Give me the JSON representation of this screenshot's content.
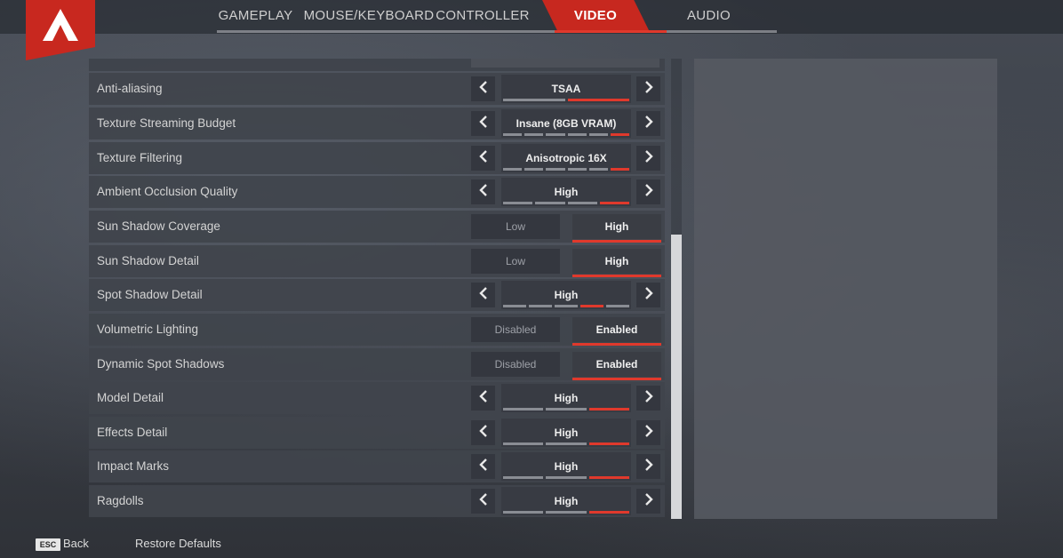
{
  "nav": {
    "tabs": [
      {
        "label": "GAMEPLAY",
        "active": false
      },
      {
        "label": "MOUSE/KEYBOARD",
        "active": false
      },
      {
        "label": "CONTROLLER",
        "active": false
      },
      {
        "label": "VIDEO",
        "active": true
      },
      {
        "label": "AUDIO",
        "active": false
      }
    ],
    "accent_color": "#c7281f"
  },
  "logo": {
    "icon": "apex-logo-icon"
  },
  "settings": [
    {
      "label": "Anti-aliasing",
      "type": "stepper",
      "value": "TSAA",
      "level": 2,
      "levels": 2
    },
    {
      "label": "Texture Streaming Budget",
      "type": "stepper",
      "value": "Insane (8GB VRAM)",
      "level": 6,
      "levels": 6
    },
    {
      "label": "Texture Filtering",
      "type": "stepper",
      "value": "Anisotropic 16X",
      "level": 6,
      "levels": 6
    },
    {
      "label": "Ambient Occlusion Quality",
      "type": "stepper",
      "value": "High",
      "level": 4,
      "levels": 4
    },
    {
      "label": "Sun Shadow Coverage",
      "type": "toggle",
      "options": [
        "Low",
        "High"
      ],
      "selected": 1
    },
    {
      "label": "Sun Shadow Detail",
      "type": "toggle",
      "options": [
        "Low",
        "High"
      ],
      "selected": 1
    },
    {
      "label": "Spot Shadow Detail",
      "type": "stepper",
      "value": "High",
      "level": 4,
      "levels": 5
    },
    {
      "label": "Volumetric Lighting",
      "type": "toggle",
      "options": [
        "Disabled",
        "Enabled"
      ],
      "selected": 1
    },
    {
      "label": "Dynamic Spot Shadows",
      "type": "toggle",
      "options": [
        "Disabled",
        "Enabled"
      ],
      "selected": 1
    },
    {
      "label": "Model Detail",
      "type": "stepper",
      "value": "High",
      "level": 3,
      "levels": 3
    },
    {
      "label": "Effects Detail",
      "type": "stepper",
      "value": "High",
      "level": 3,
      "levels": 3
    },
    {
      "label": "Impact Marks",
      "type": "stepper",
      "value": "High",
      "level": 3,
      "levels": 3
    },
    {
      "label": "Ragdolls",
      "type": "stepper",
      "value": "High",
      "level": 3,
      "levels": 3
    }
  ],
  "footer": {
    "esc_key": "ESC",
    "back_label": "Back",
    "restore_label": "Restore Defaults"
  }
}
